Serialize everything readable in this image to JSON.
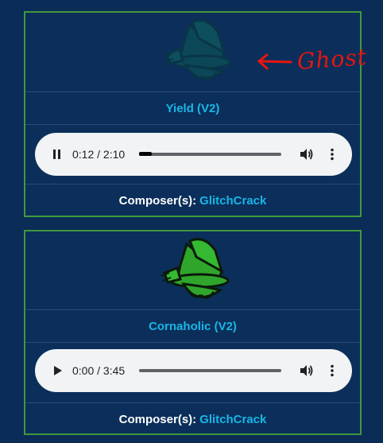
{
  "cards": [
    {
      "title": "Yield (V2)",
      "player": {
        "time": "0:12 / 2:10",
        "progress": 0.09,
        "state": "playing"
      },
      "composer_label": "Composer(s):",
      "composer_name": "GlitchCrack",
      "image": "ghost-leaf-creature",
      "image_color": "#0d5c56"
    },
    {
      "title": "Cornaholic (V2)",
      "player": {
        "time": "0:00 / 3:45",
        "progress": 0.0,
        "state": "paused"
      },
      "composer_label": "Composer(s):",
      "composer_name": "GlitchCrack",
      "image": "green-leaf-creature",
      "image_color": "#2fa52c"
    }
  ],
  "annotation": {
    "text": "Ghost",
    "color": "#e8150f"
  },
  "colors": {
    "background": "#0a2c57",
    "accent": "#19b6e8",
    "border": "#3f9a3c"
  }
}
